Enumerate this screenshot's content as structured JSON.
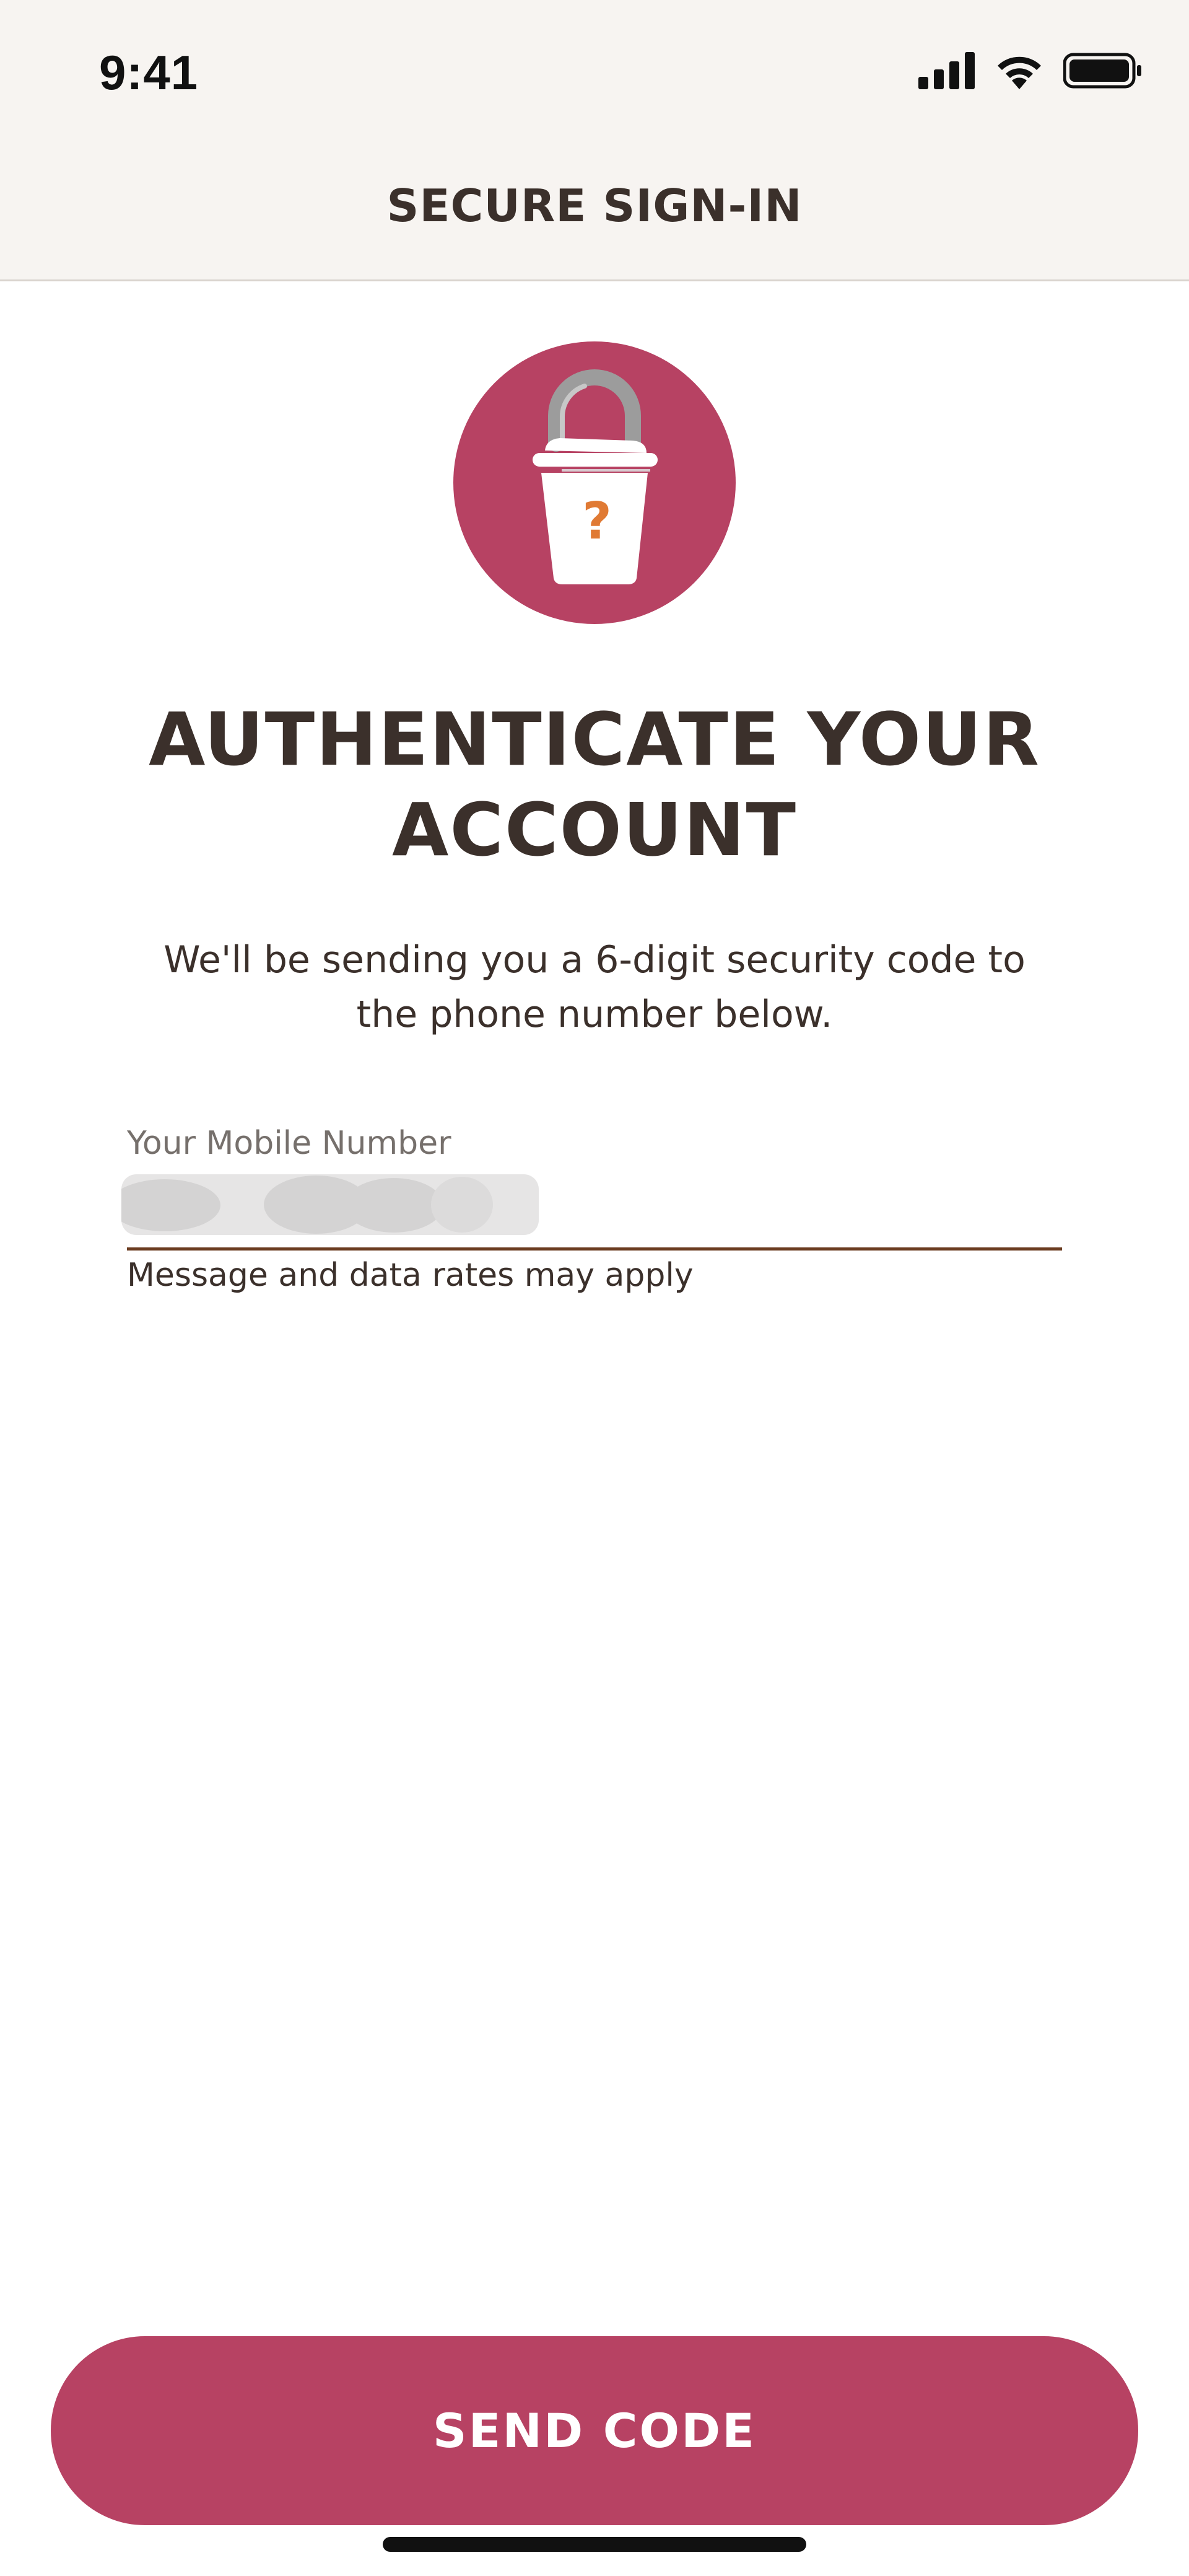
{
  "status_bar": {
    "time": "9:41",
    "icons": [
      "cellular-signal-icon",
      "wifi-icon",
      "battery-icon"
    ]
  },
  "header": {
    "title": "SECURE SIGN-IN"
  },
  "hero": {
    "icon": "locked-coffee-cup-icon",
    "glyph": "?",
    "circle_color": "#b74263",
    "glyph_color": "#e07a34"
  },
  "main": {
    "headline_line1": "AUTHENTICATE YOUR",
    "headline_line2": "ACCOUNT",
    "subtitle_line1": "We'll be sending you a 6-digit security code to",
    "subtitle_line2": "the phone number below."
  },
  "phone_field": {
    "label": "Your Mobile Number",
    "value_redacted": true,
    "helper": "Message and data rates may apply",
    "underline_color": "#6a3b1f"
  },
  "actions": {
    "send_code_label": "SEND CODE",
    "button_color": "#b74263"
  }
}
